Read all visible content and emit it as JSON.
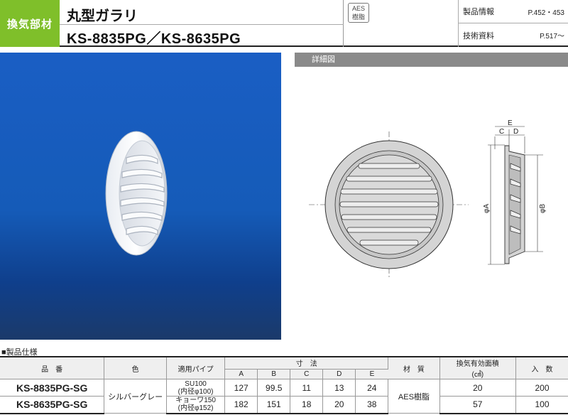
{
  "header": {
    "category": "換気部材",
    "title": "丸型ガラリ",
    "models": "KS-8835PG／KS-8635PG",
    "badge_line1": "AES",
    "badge_line2": "樹脂",
    "info": [
      {
        "label": "製品情報",
        "value": "P.452・453"
      },
      {
        "label": "技術資料",
        "value": "P.517～"
      }
    ],
    "category_color": "#7fbf2a"
  },
  "detail": {
    "label": "詳細図",
    "dim_labels": {
      "e": "E",
      "c": "C",
      "d": "D",
      "a": "φA",
      "b": "φB"
    }
  },
  "spec": {
    "section_title": "■製品仕様",
    "headers": {
      "product": "品　番",
      "color": "色",
      "pipe": "適用パイプ",
      "dimensions": "寸　法",
      "a": "A",
      "b": "B",
      "c": "C",
      "d": "D",
      "e": "E",
      "material": "材　質",
      "area_line1": "換気有効面積",
      "area_line2": "(㎠)",
      "qty": "入　数"
    },
    "color_value": "シルバーグレー",
    "material_value": "AES樹脂",
    "rows": [
      {
        "model": "KS-8835PG-SG",
        "pipe_line1": "SU100",
        "pipe_line2": "(内径φ100)",
        "a": "127",
        "b": "99.5",
        "c": "11",
        "d": "13",
        "e": "24",
        "area": "20",
        "qty": "200"
      },
      {
        "model": "KS-8635PG-SG",
        "pipe_line1": "キョーワ150",
        "pipe_line2": "(内径φ152)",
        "a": "182",
        "b": "151",
        "c": "18",
        "d": "20",
        "e": "38",
        "area": "57",
        "qty": "100"
      }
    ]
  }
}
